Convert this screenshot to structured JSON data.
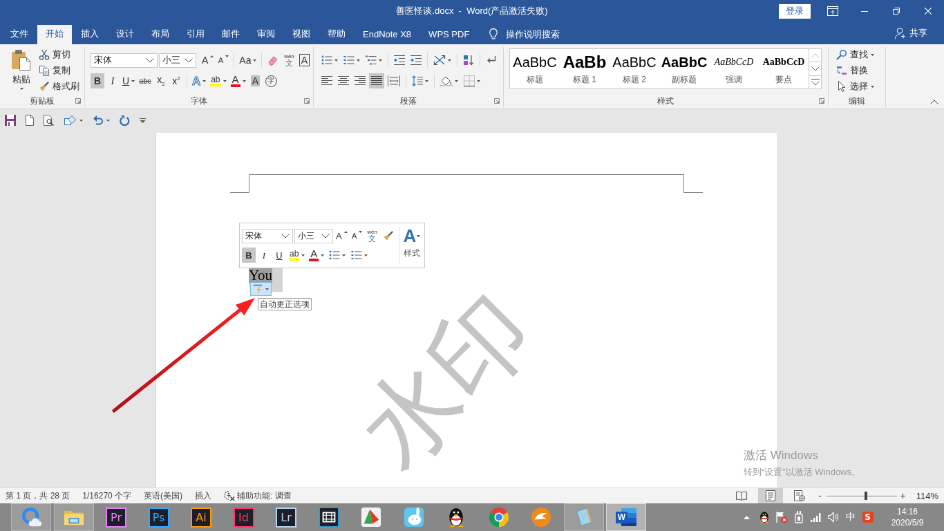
{
  "window": {
    "title": "善医怪谈.docx  -  Word(产品激活失败)",
    "sign_in": "登录"
  },
  "tabs": [
    {
      "label": "文件",
      "selected": false
    },
    {
      "label": "开始",
      "selected": true
    },
    {
      "label": "插入",
      "selected": false
    },
    {
      "label": "设计",
      "selected": false
    },
    {
      "label": "布局",
      "selected": false
    },
    {
      "label": "引用",
      "selected": false
    },
    {
      "label": "邮件",
      "selected": false
    },
    {
      "label": "审阅",
      "selected": false
    },
    {
      "label": "视图",
      "selected": false
    },
    {
      "label": "帮助",
      "selected": false
    },
    {
      "label": "EndNote X8",
      "selected": false
    },
    {
      "label": "WPS PDF",
      "selected": false
    }
  ],
  "tell_me": {
    "placeholder": "操作说明搜索"
  },
  "share": "共享",
  "ribbon": {
    "clipboard": {
      "label": "剪贴板",
      "paste": "粘贴",
      "commands": [
        "剪切",
        "复制",
        "格式刷"
      ]
    },
    "font": {
      "label": "字体",
      "font_name": "宋体",
      "font_size": "小三",
      "grow": "A",
      "shrink": "A",
      "change_case": "Aa",
      "phonetic": {
        "ruby": "wén",
        "base": "文"
      },
      "char_border": "A",
      "formats": [
        {
          "glyph": "B",
          "on": true,
          "dropdown": false
        },
        {
          "glyph": "I",
          "on": false,
          "dropdown": false
        },
        {
          "glyph": "U",
          "on": false,
          "dropdown": true
        },
        {
          "glyph": "abc",
          "on": false,
          "dropdown": false
        },
        {
          "glyph": "x$_{2}$",
          "on": false,
          "dropdown": false
        },
        {
          "glyph": "x$^{2}$",
          "on": false,
          "dropdown": false
        }
      ],
      "text_effects": "A",
      "highlight": "ab",
      "font_color": "A",
      "char_shading": "A",
      "enclose": "字"
    },
    "paragraph": {
      "label": "段落",
      "alignment": [
        {
          "selected": false
        },
        {
          "selected": false
        },
        {
          "selected": false
        },
        {
          "selected": true
        },
        {
          "selected": false
        }
      ]
    },
    "styles": {
      "label": "样式",
      "items": [
        {
          "preview": "AaBbC",
          "name": "标题",
          "kind": "light"
        },
        {
          "preview": "AaBb",
          "name": "标题 1",
          "kind": "heavy"
        },
        {
          "preview": "AaBbC",
          "name": "标题 2",
          "kind": "light"
        },
        {
          "preview": "AaBbC",
          "name": "副标题",
          "kind": "bold"
        },
        {
          "preview": "AaBbCcD",
          "name": "强调",
          "kind": "italic"
        },
        {
          "preview": "AaBbCcD",
          "name": "要点",
          "kind": "strong"
        }
      ]
    },
    "editing": {
      "label": "编辑",
      "commands": [
        {
          "label": "查找",
          "dropdown": true
        },
        {
          "label": "替换",
          "dropdown": false
        },
        {
          "label": "选择",
          "dropdown": true
        }
      ]
    }
  },
  "document": {
    "watermark_text": "水印",
    "selected_text": "You",
    "autocorrect_tooltip": "自动更正选项",
    "mini_toolbar": {
      "font_name": "宋体",
      "font_size": "小三",
      "grow": "A",
      "shrink": "A",
      "phonetic": {
        "ruby": "wén",
        "base": "文"
      },
      "styles_glyph": "A",
      "styles_label": "样式",
      "formats": [
        {
          "glyph": "B",
          "on": true
        },
        {
          "glyph": "I",
          "on": false
        },
        {
          "glyph": "U",
          "on": false
        }
      ],
      "highlight": "ab",
      "font_color": "A"
    }
  },
  "activation": {
    "title": "激活 Windows",
    "hint": "转到“设置”以激活 Windows。"
  },
  "status_bar": {
    "items": [
      "第 1 页，共 28 页",
      "1/16270 个字",
      "英语(美国)",
      "插入"
    ],
    "accessibility": "辅助功能: 调查",
    "views": [
      {
        "selected": false
      },
      {
        "selected": true
      },
      {
        "selected": false
      }
    ],
    "zoom_out": "-",
    "zoom_in": "+",
    "zoom": {
      "level": 0.56,
      "reading": "114%"
    }
  },
  "taskbar": {
    "apps": [
      {
        "open": true,
        "active": false
      },
      {
        "open": true,
        "active": false
      },
      {
        "label": "Pr",
        "color": "#e77efc",
        "open": false,
        "active": false
      },
      {
        "label": "Ps",
        "color": "#31a8ff",
        "open": false,
        "active": false
      },
      {
        "label": "Ai",
        "color": "#ff9a00",
        "open": false,
        "active": false
      },
      {
        "label": "Id",
        "color": "#ff3366",
        "open": false,
        "active": false
      },
      {
        "label": "Lr",
        "color": "#add5ec",
        "open": false,
        "active": false
      },
      {
        "open": false,
        "active": false
      },
      {
        "open": false,
        "active": false
      },
      {
        "open": false,
        "active": false
      },
      {
        "open": false,
        "active": false
      },
      {
        "open": false,
        "active": false
      },
      {
        "open": false,
        "active": false
      },
      {
        "open": true,
        "active": false
      },
      {
        "label": "W",
        "open": true,
        "active": true
      }
    ],
    "ime": "中",
    "ime_logo": "S",
    "time": "14:16",
    "date": "2020/5/9"
  }
}
